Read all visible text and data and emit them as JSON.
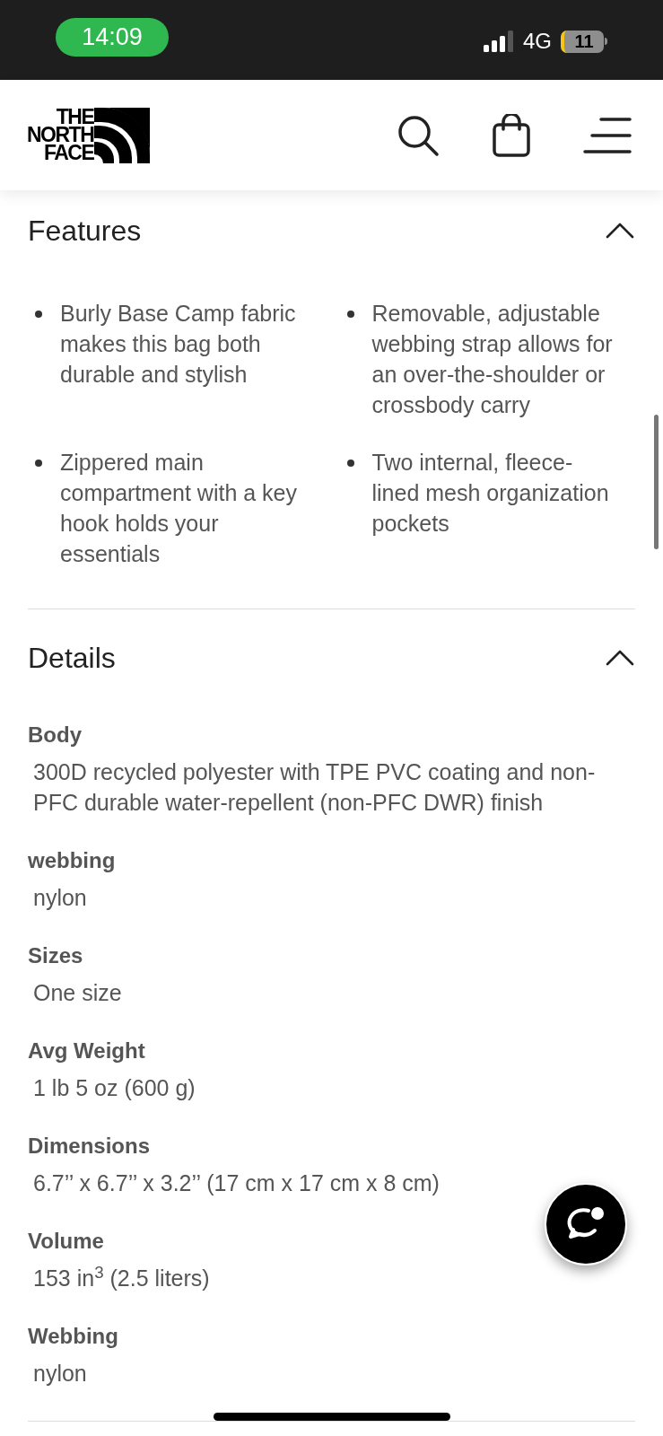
{
  "status_bar": {
    "time": "14:09",
    "network": "4G",
    "battery": "11"
  },
  "header": {
    "logo": [
      "THE",
      "NORTH",
      "FACE"
    ]
  },
  "features": {
    "title": "Features",
    "expanded": true,
    "items": [
      {
        "text": "Burly Base Camp fabric makes this bag both durable and stylish"
      },
      {
        "text": "Removable, adjustable webbing strap allows for an over-the-shoulder or crossbody carry"
      },
      {
        "text": "Zippered main compartment with a key hook holds your essentials"
      },
      {
        "text": "Two internal, fleece-lined mesh organization pockets"
      }
    ]
  },
  "details": {
    "title": "Details",
    "expanded": true,
    "items": [
      {
        "label": "Body",
        "value": "300D recycled polyester with TPE PVC coating and non-PFC durable water-repellent (non-PFC DWR) finish"
      },
      {
        "label": "webbing",
        "value": "nylon"
      },
      {
        "label": "Sizes",
        "value": "One size"
      },
      {
        "label": "Avg Weight",
        "value": "1 lb 5 oz (600 g)"
      },
      {
        "label": "Dimensions",
        "value": "6.7’’ x 6.7’’ x 3.2’’ (17 cm x 17 cm x 8 cm)"
      },
      {
        "label": "Volume",
        "value": "153 in$^{3}$ (2.5 liters)"
      },
      {
        "label": "Webbing",
        "value": "nylon"
      }
    ]
  }
}
